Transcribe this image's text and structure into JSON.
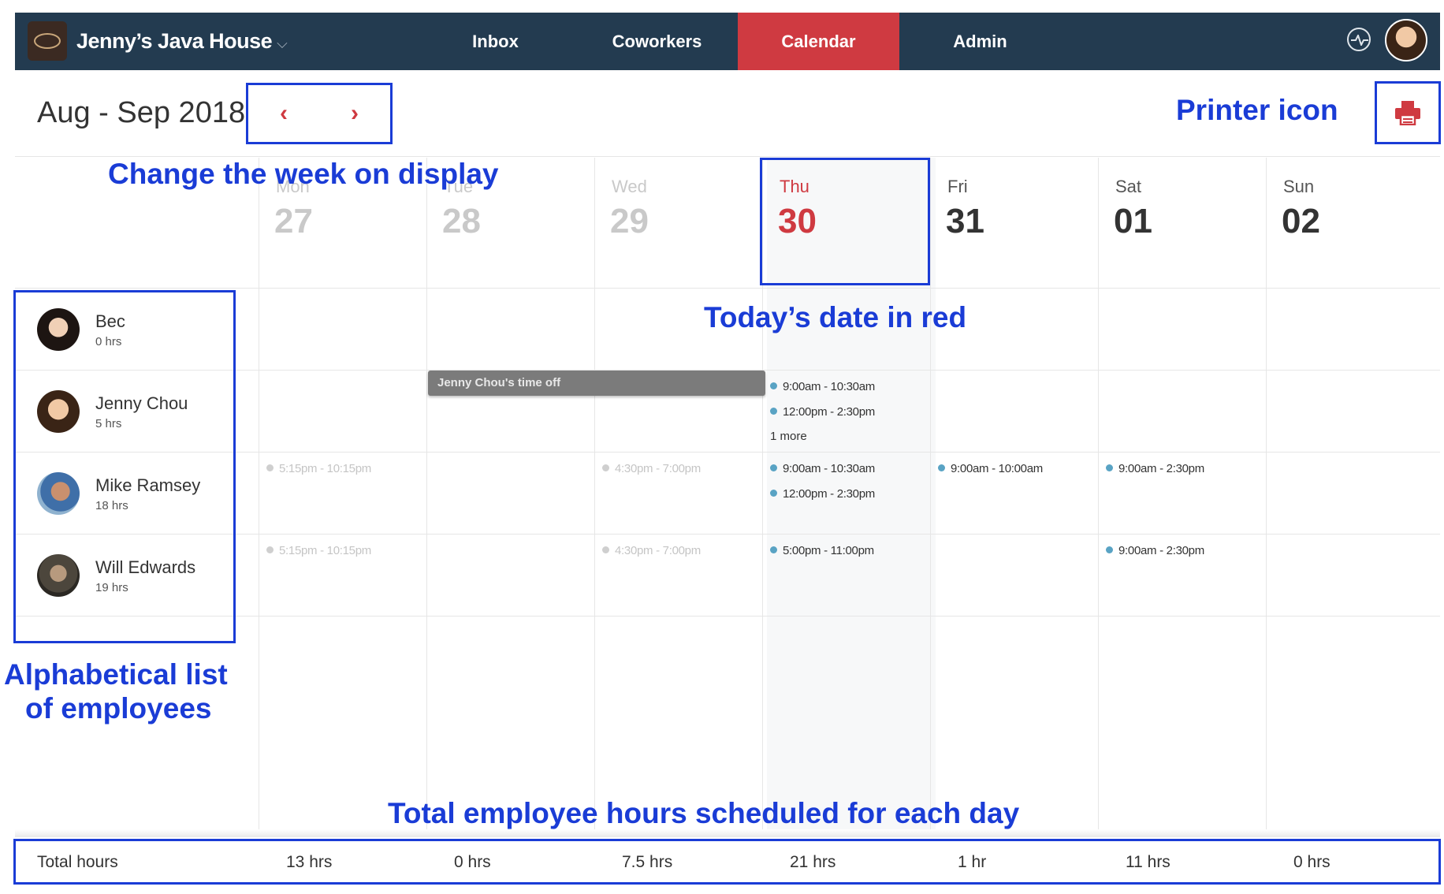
{
  "nav": {
    "brand": "Jenny’s Java House",
    "brand_chevron": "⌵",
    "items": [
      {
        "label": "Inbox",
        "active": false
      },
      {
        "label": "Coworkers",
        "active": false
      },
      {
        "label": "Calendar",
        "active": true
      },
      {
        "label": "Admin",
        "active": false
      }
    ],
    "activity_icon": "activity-icon",
    "avatar_icon": "user-avatar"
  },
  "header": {
    "date_range": "Aug - Sep 2018",
    "prev": "‹",
    "next": "›",
    "print_icon": "printer-icon"
  },
  "annotations": {
    "week_nav": "Change the week on display",
    "printer": "Printer icon",
    "today": "Today’s date in red",
    "employees_line1": "Alphabetical list",
    "employees_line2": "of employees",
    "totals": "Total employee hours scheduled for each day"
  },
  "days": [
    {
      "name": "Mon",
      "num": "27",
      "state": "past"
    },
    {
      "name": "Tue",
      "num": "28",
      "state": "past"
    },
    {
      "name": "Wed",
      "num": "29",
      "state": "past"
    },
    {
      "name": "Thu",
      "num": "30",
      "state": "today"
    },
    {
      "name": "Fri",
      "num": "31",
      "state": "future"
    },
    {
      "name": "Sat",
      "num": "01",
      "state": "future"
    },
    {
      "name": "Sun",
      "num": "02",
      "state": "future"
    }
  ],
  "employees": [
    {
      "name": "Bec",
      "hours": "0 hrs"
    },
    {
      "name": "Jenny Chou",
      "hours": "5 hrs"
    },
    {
      "name": "Mike Ramsey",
      "hours": "18 hrs"
    },
    {
      "name": "Will Edwards",
      "hours": "19 hrs"
    }
  ],
  "time_off": {
    "label": "Jenny Chou's time off"
  },
  "shifts": {
    "jenny_thu_1": "9:00am - 10:30am",
    "jenny_thu_2": "12:00pm - 2:30pm",
    "jenny_thu_more": "1 more",
    "mike_mon": "5:15pm - 10:15pm",
    "mike_wed": "4:30pm - 7:00pm",
    "mike_thu_1": "9:00am - 10:30am",
    "mike_thu_2": "12:00pm - 2:30pm",
    "mike_fri": "9:00am - 10:00am",
    "mike_sat": "9:00am - 2:30pm",
    "will_mon": "5:15pm - 10:15pm",
    "will_wed": "4:30pm - 7:00pm",
    "will_thu": "5:00pm - 11:00pm",
    "will_sat": "9:00am - 2:30pm"
  },
  "totals": {
    "label": "Total hours",
    "values": [
      "13 hrs",
      "0 hrs",
      "7.5 hrs",
      "21 hrs",
      "1 hr",
      "11 hrs",
      "0 hrs"
    ]
  },
  "colors": {
    "nav_bg": "#233b50",
    "accent_red": "#cf3a41",
    "annotation_blue": "#1a3cd6",
    "shift_dot": "#59a3c4"
  }
}
